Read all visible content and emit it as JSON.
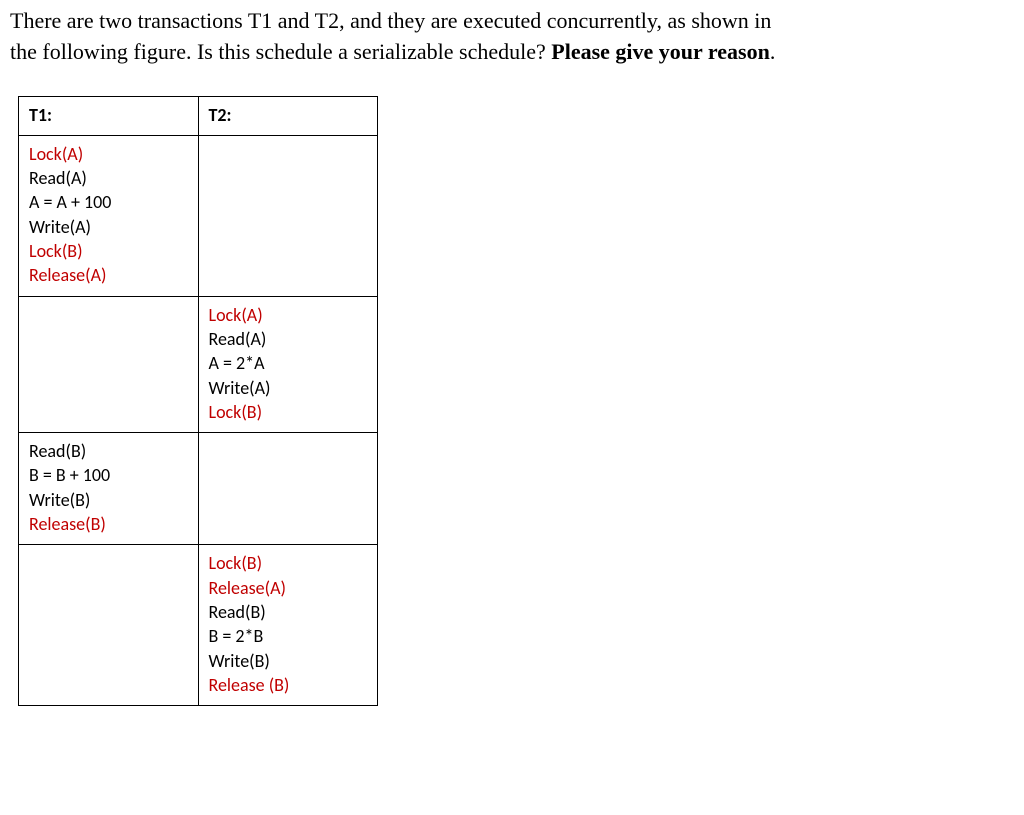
{
  "question": {
    "line1": "There are two transactions T1 and T2, and they are executed concurrently, as shown in",
    "line2a": "the following figure. Is this schedule a serializable schedule? ",
    "line2b": "Please give your reason",
    "line2c": "."
  },
  "headers": {
    "t1": "T1:",
    "t2": "T2:"
  },
  "steps": {
    "s1t1": [
      {
        "txt": "Lock(A)",
        "red": true
      },
      {
        "txt": "Read(A)",
        "red": false
      },
      {
        "txt": "A = A + 100",
        "red": false
      },
      {
        "txt": "Write(A)",
        "red": false
      },
      {
        "txt": "Lock(B)",
        "red": true
      },
      {
        "txt": "Release(A)",
        "red": true
      }
    ],
    "s2t2": [
      {
        "txt": "Lock(A)",
        "red": true
      },
      {
        "txt": "Read(A)",
        "red": false
      },
      {
        "txt": "A = 2*A",
        "red": false
      },
      {
        "txt": "Write(A)",
        "red": false
      },
      {
        "txt": "Lock(B)",
        "red": true
      }
    ],
    "s3t1": [
      {
        "txt": "Read(B)",
        "red": false
      },
      {
        "txt": "B = B + 100",
        "red": false
      },
      {
        "txt": "Write(B)",
        "red": false
      },
      {
        "txt": "Release(B)",
        "red": true
      }
    ],
    "s4t2": [
      {
        "txt": "Lock(B)",
        "red": true
      },
      {
        "txt": "Release(A)",
        "red": true
      },
      {
        "txt": "Read(B)",
        "red": false
      },
      {
        "txt": "B = 2*B",
        "red": false
      },
      {
        "txt": "Write(B)",
        "red": false
      },
      {
        "txt": "Release (B)",
        "red": true
      }
    ]
  }
}
